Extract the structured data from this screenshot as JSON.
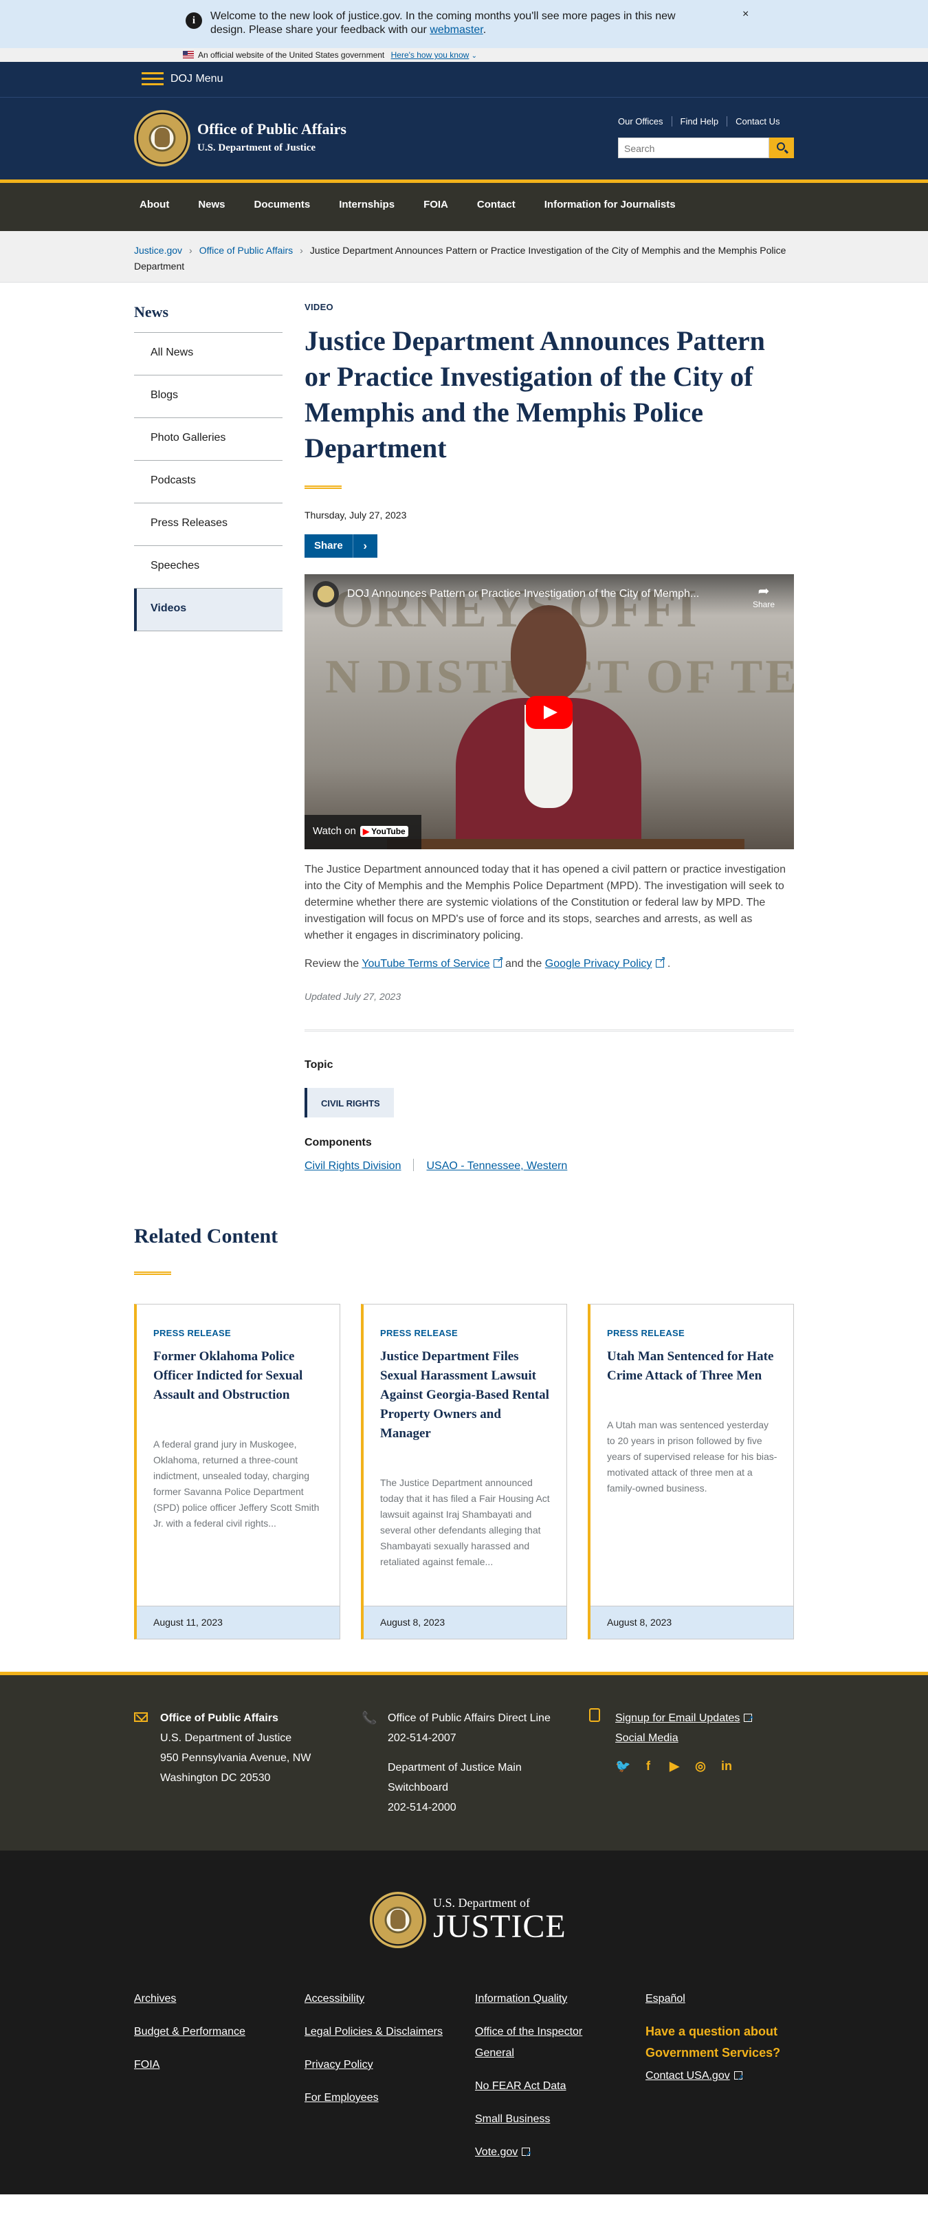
{
  "banner": {
    "message": "Welcome to the new look of justice.gov. In the coming months you'll see more pages in this new design. Please share your feedback with our",
    "link": "webmaster",
    "close": "×"
  },
  "gov_banner": {
    "text": "An official website of the United States government",
    "link": "Here's how you know"
  },
  "header": {
    "menu_label": "DOJ Menu",
    "title": "Office of Public Affairs",
    "subtitle": "U.S. Department of Justice",
    "util_links": [
      "Our Offices",
      "Find Help",
      "Contact Us"
    ],
    "search_placeholder": "Search"
  },
  "nav": [
    "About",
    "News",
    "Documents",
    "Internships",
    "FOIA",
    "Contact",
    "Information for Journalists"
  ],
  "breadcrumb": {
    "items": [
      "Justice.gov",
      "Office of Public Affairs"
    ],
    "current": "Justice Department Announces Pattern or Practice Investigation of the City of Memphis and the Memphis Police Department"
  },
  "sidenav": {
    "title": "News",
    "items": [
      "All News",
      "Blogs",
      "Photo Galleries",
      "Podcasts",
      "Press Releases",
      "Speeches",
      "Videos"
    ],
    "active": "Videos"
  },
  "article": {
    "type": "VIDEO",
    "title": "Justice Department Announces Pattern or Practice Investigation of the City of Memphis and the Memphis Police Department",
    "date": "Thursday, July 27, 2023",
    "share": "Share",
    "video": {
      "title": "DOJ Announces Pattern or Practice Investigation of the City of Memph...",
      "share": "Share",
      "watch_on": "Watch on",
      "youtube": "YouTube",
      "bg_text_1": "ORNEYS OFFI",
      "bg_text_2": "N DISTRICT OF TENN"
    },
    "body": "The Justice Department announced today that it has opened a civil pattern or practice investigation into the City of Memphis and the Memphis Police Department (MPD). The investigation will seek to determine whether there are systemic violations of the Constitution or federal law by MPD. The investigation will focus on MPD's use of force and its stops, searches and arrests, as well as whether it engages in discriminatory policing.",
    "review_prefix": "Review the",
    "review_link1": "YouTube Terms of Service",
    "review_mid": "and the",
    "review_link2": "Google Privacy Policy",
    "review_suffix": ".",
    "updated": "Updated July 27, 2023",
    "topic_heading": "Topic",
    "topic": "CIVIL RIGHTS",
    "components_heading": "Components",
    "components": [
      "Civil Rights Division",
      "USAO - Tennessee, Western"
    ]
  },
  "related": {
    "heading": "Related Content",
    "cards": [
      {
        "type": "PRESS RELEASE",
        "title": "Former Oklahoma Police Officer Indicted for Sexual Assault and Obstruction",
        "summary": "A federal grand jury in Muskogee, Oklahoma, returned a three-count indictment, unsealed today, charging former Savanna Police Department (SPD) police officer Jeffery Scott Smith Jr. with a federal civil rights...",
        "date": "August 11, 2023"
      },
      {
        "type": "PRESS RELEASE",
        "title": "Justice Department Files Sexual Harassment Lawsuit Against Georgia-Based Rental Property Owners and Manager",
        "summary": "The Justice Department announced today that it has filed a Fair Housing Act lawsuit against Iraj Shambayati and several other defendants alleging that Shambayati sexually harassed and retaliated against female...",
        "date": "August 8, 2023"
      },
      {
        "type": "PRESS RELEASE",
        "title": "Utah Man Sentenced for Hate Crime Attack of Three Men",
        "summary": "A Utah man was sentenced yesterday to 20 years in prison followed by five years of supervised release for his bias-motivated attack of three men at a family-owned business.",
        "date": "August 8, 2023"
      }
    ]
  },
  "footer": {
    "address": {
      "name": "Office of Public Affairs",
      "line1": "U.S. Department of Justice",
      "line2": "950 Pennsylvania Avenue, NW",
      "line3": "Washington DC 20530"
    },
    "phones": {
      "label1": "Office of Public Affairs Direct Line",
      "number1": "202-514-2007",
      "label2a": "Department of Justice Main",
      "label2b": "Switchboard",
      "number2": "202-514-2000"
    },
    "signup": {
      "email": "Signup for Email Updates",
      "social": "Social Media"
    },
    "brand": {
      "line1": "U.S. Department of",
      "line2": "JUSTICE"
    },
    "links_col1": [
      "Archives",
      "Budget & Performance",
      "FOIA"
    ],
    "links_col2": [
      "Accessibility",
      "Legal Policies & Disclaimers",
      "Privacy Policy",
      "For Employees"
    ],
    "links_col3": [
      "Information Quality",
      "Office of the Inspector General",
      "No FEAR Act Data",
      "Small Business",
      "Vote.gov"
    ],
    "links_col4": {
      "espanol": "Español",
      "question": "Have a question about Government Services?",
      "contact": "Contact USA.gov"
    }
  },
  "colors": {
    "navy": "#162e51",
    "gold": "#f2b21b",
    "link": "#005ea2",
    "nav_bg": "#33332c"
  }
}
